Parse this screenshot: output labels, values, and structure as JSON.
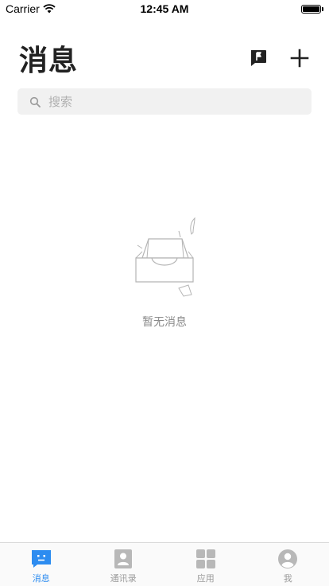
{
  "status_bar": {
    "carrier": "Carrier",
    "time": "12:45 AM"
  },
  "header": {
    "title": "消息",
    "icons": [
      "flag-chat-icon",
      "plus-icon"
    ]
  },
  "search": {
    "placeholder": "搜索"
  },
  "empty_state": {
    "message": "暂无消息",
    "icon": "empty-inbox-icon"
  },
  "tab_bar": {
    "active_index": 0,
    "active_color": "#2d8cf0",
    "inactive_color": "#b8b8b8",
    "tabs": [
      {
        "label": "消息",
        "icon": "message-icon"
      },
      {
        "label": "通讯录",
        "icon": "contacts-icon"
      },
      {
        "label": "应用",
        "icon": "apps-grid-icon"
      },
      {
        "label": "我",
        "icon": "profile-icon"
      }
    ]
  }
}
